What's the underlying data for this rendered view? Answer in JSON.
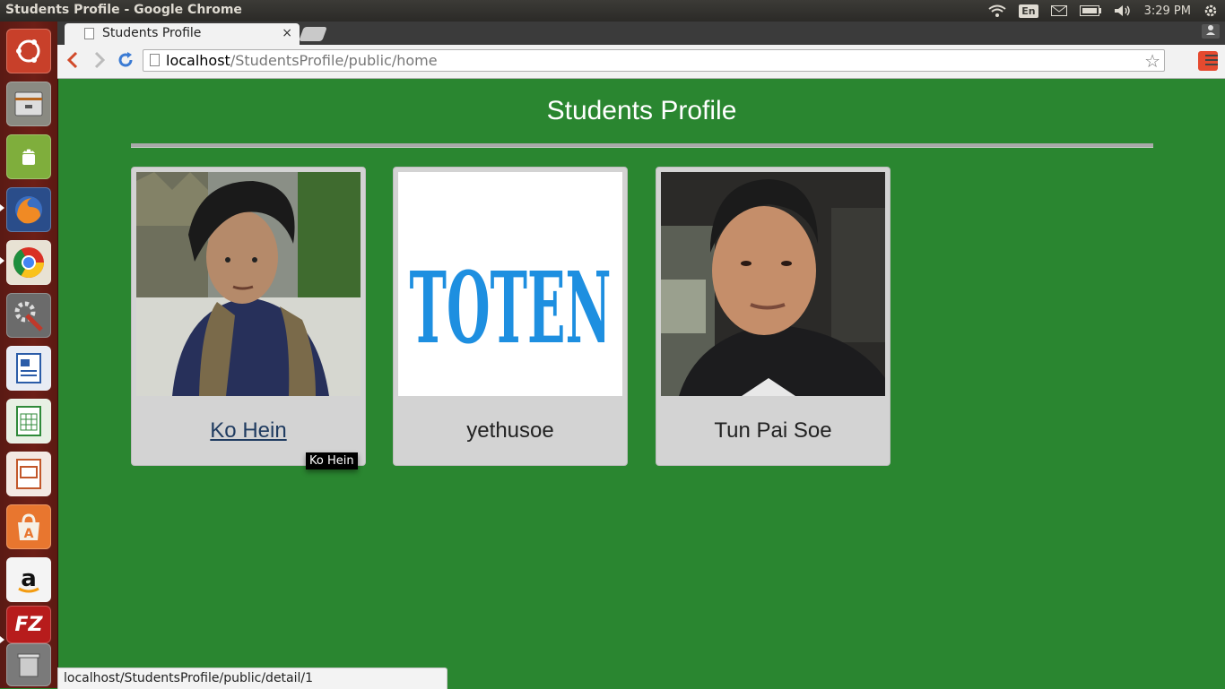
{
  "window": {
    "title": "Students Profile - Google Chrome"
  },
  "tray": {
    "lang": "En",
    "time": "3:29 PM"
  },
  "browser": {
    "tab_title": "Students Profile",
    "tab_close": "×",
    "url_host": "localhost",
    "url_path": "/StudentsProfile/public/home",
    "status_url": "localhost/StudentsProfile/public/detail/1"
  },
  "page": {
    "title": "Students Profile",
    "students": [
      {
        "name": "Ko Hein"
      },
      {
        "name": "yethusoe"
      },
      {
        "name": "Tun Pai Soe"
      }
    ],
    "logo_text": "TOTEN",
    "tooltip": "Ko Hein"
  },
  "colors": {
    "page_bg": "#2a8630",
    "card_bg": "#d3d3d3",
    "logo_blue": "#1e8fe0"
  },
  "launcher": {
    "items": [
      "ubuntu-dash-icon",
      "files-icon",
      "android-icon",
      "firefox-icon",
      "chrome-icon",
      "system-settings-icon",
      "writer-icon",
      "calc-icon",
      "impress-icon",
      "software-center-icon",
      "amazon-icon",
      "filezilla-icon",
      "trash-icon"
    ],
    "amazon_letter": "a",
    "filezilla_letters": "FZ"
  }
}
